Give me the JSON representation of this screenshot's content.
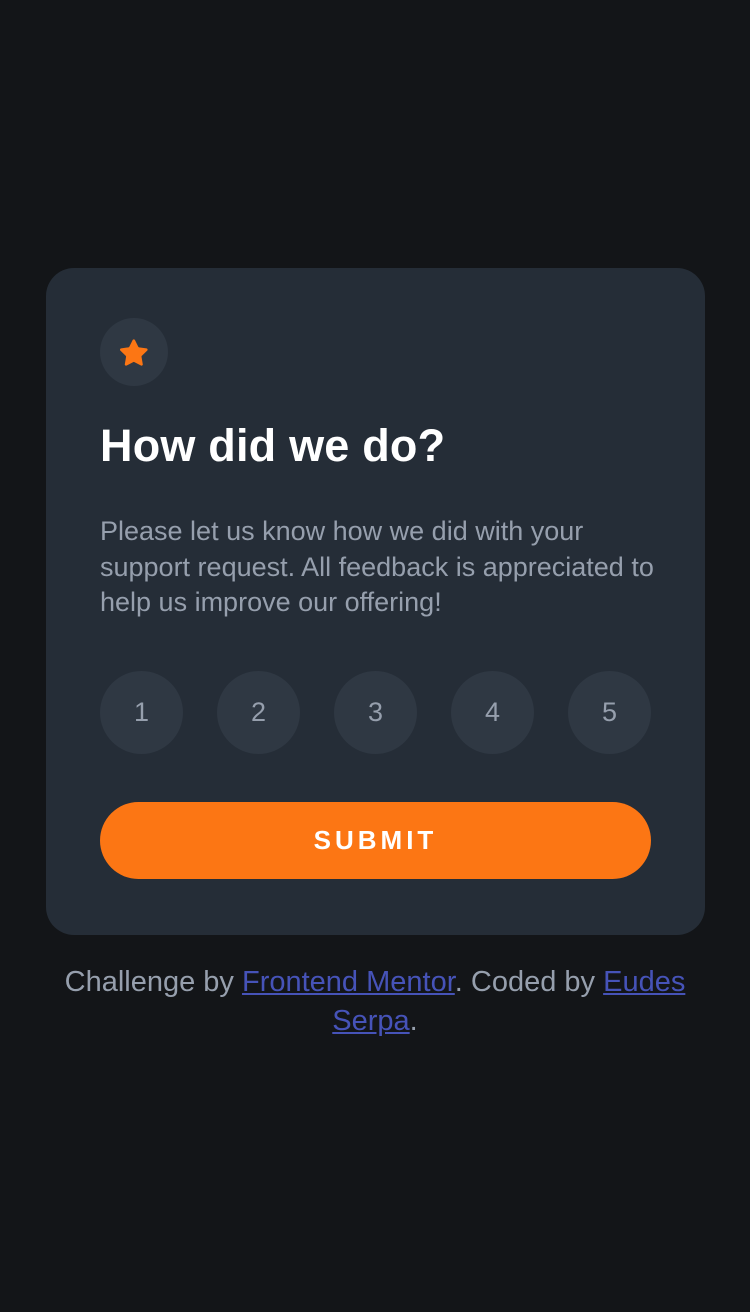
{
  "card": {
    "icon": "star-icon",
    "title": "How did we do?",
    "description": "Please let us know how we did with your support request. All feedback is appreciated to help us improve our offering!",
    "ratings": [
      "1",
      "2",
      "3",
      "4",
      "5"
    ],
    "submit_label": "SUBMIT"
  },
  "attribution": {
    "prefix": "Challenge by ",
    "link1_text": "Frontend Mentor",
    "middle": ". Coded by ",
    "link2_text": "Eudes Serpa",
    "suffix": "."
  },
  "colors": {
    "background": "#131518",
    "card": "#252d37",
    "accent": "#fc7614",
    "muted_text": "#969fad",
    "link": "#4653b8"
  }
}
